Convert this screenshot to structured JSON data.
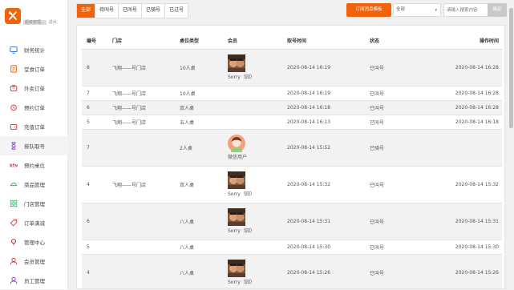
{
  "sidebar": {
    "admin_name": "超级管理...",
    "logout": "退出",
    "items": [
      {
        "label": "财务统计",
        "icon": "monitor-icon",
        "color": "#3b7bd8"
      },
      {
        "label": "堂食订单",
        "icon": "receipt-icon",
        "color": "#f2620a"
      },
      {
        "label": "外卖订单",
        "icon": "takeout-icon",
        "color": "#e63b3b"
      },
      {
        "label": "预约订单",
        "icon": "alarm-clock-icon",
        "color": "#e63b3b"
      },
      {
        "label": "充值订单",
        "icon": "wallet-icon",
        "color": "#e63b3b"
      },
      {
        "label": "排队取号",
        "icon": "hourglass-icon",
        "color": "#8a3fd1"
      },
      {
        "label": "预约桌位",
        "icon": "ktv-icon",
        "color": "#e63b3b"
      },
      {
        "label": "菜品管理",
        "icon": "dish-icon",
        "color": "#2fb45a"
      },
      {
        "label": "门店管理",
        "icon": "grid-icon",
        "color": "#2fb45a"
      },
      {
        "label": "订单满减",
        "icon": "tag-icon",
        "color": "#e63b3b"
      },
      {
        "label": "管理中心",
        "icon": "pin-icon",
        "color": "#e63b3b"
      },
      {
        "label": "会员管理",
        "icon": "user-icon",
        "color": "#e63b3b"
      },
      {
        "label": "员工管理",
        "icon": "staff-icon",
        "color": "#8a3fd1"
      }
    ]
  },
  "toolbar": {
    "tabs": [
      "全部",
      "待叫号",
      "已叫号",
      "已骑号",
      "已过号"
    ],
    "subscribe_label": "订阅消息模板",
    "select_value": "全部",
    "search_placeholder": "请输入搜索内容",
    "confirm_label": "确定"
  },
  "table": {
    "headers": [
      "编号",
      "门店",
      "桌位类型",
      "会员",
      "取号时间",
      "状态",
      "操作时间"
    ],
    "rows": [
      {
        "id": "8",
        "store": "飞翔——号门店",
        "table": "10人桌",
        "member": "Sorry（囧）",
        "avatar": "photo",
        "time": "2020-08-14 16:19",
        "status": "已叫号",
        "op": "2020-08-14 16:28"
      },
      {
        "id": "7",
        "store": "飞翔——号门店",
        "table": "10人桌",
        "member": "",
        "avatar": "",
        "time": "2020-08-14 16:19",
        "status": "已叫号",
        "op": "2020-08-14 16:28"
      },
      {
        "id": "6",
        "store": "飞翔——号门店",
        "table": "双人桌",
        "member": "",
        "avatar": "",
        "time": "2020-08-14 16:18",
        "status": "已叫号",
        "op": "2020-08-14 16:28"
      },
      {
        "id": "5",
        "store": "飞翔——号门店",
        "table": "五人桌",
        "member": "",
        "avatar": "",
        "time": "2020-08-14 16:13",
        "status": "已叫号",
        "op": "2020-08-14 16:18"
      },
      {
        "id": "7",
        "store": "",
        "table": "2人桌",
        "member": "微信用户",
        "avatar": "cartoon",
        "time": "2020-08-14 15:52",
        "status": "已骑号",
        "op": ""
      },
      {
        "id": "4",
        "store": "飞翔——号门店",
        "table": "双人桌",
        "member": "Sorry（囧）",
        "avatar": "photo",
        "time": "2020-08-14 15:32",
        "status": "已叫号",
        "op": "2020-08-14 15:32"
      },
      {
        "id": "6",
        "store": "",
        "table": "八人桌",
        "member": "Sorry（囧）",
        "avatar": "photo",
        "time": "2020-08-14 15:31",
        "status": "已叫号",
        "op": "2020-08-14 15:31"
      },
      {
        "id": "5",
        "store": "",
        "table": "八人桌",
        "member": "",
        "avatar": "",
        "time": "2020-08-14 15:30",
        "status": "已叫号",
        "op": "2020-08-14 15:30"
      },
      {
        "id": "4",
        "store": "",
        "table": "八人桌",
        "member": "Sorry（囧）",
        "avatar": "photo",
        "time": "2020-08-14 15:26",
        "status": "已叫号",
        "op": "2020-08-14 15:26"
      }
    ]
  },
  "colors": {
    "accent": "#f2620a"
  }
}
